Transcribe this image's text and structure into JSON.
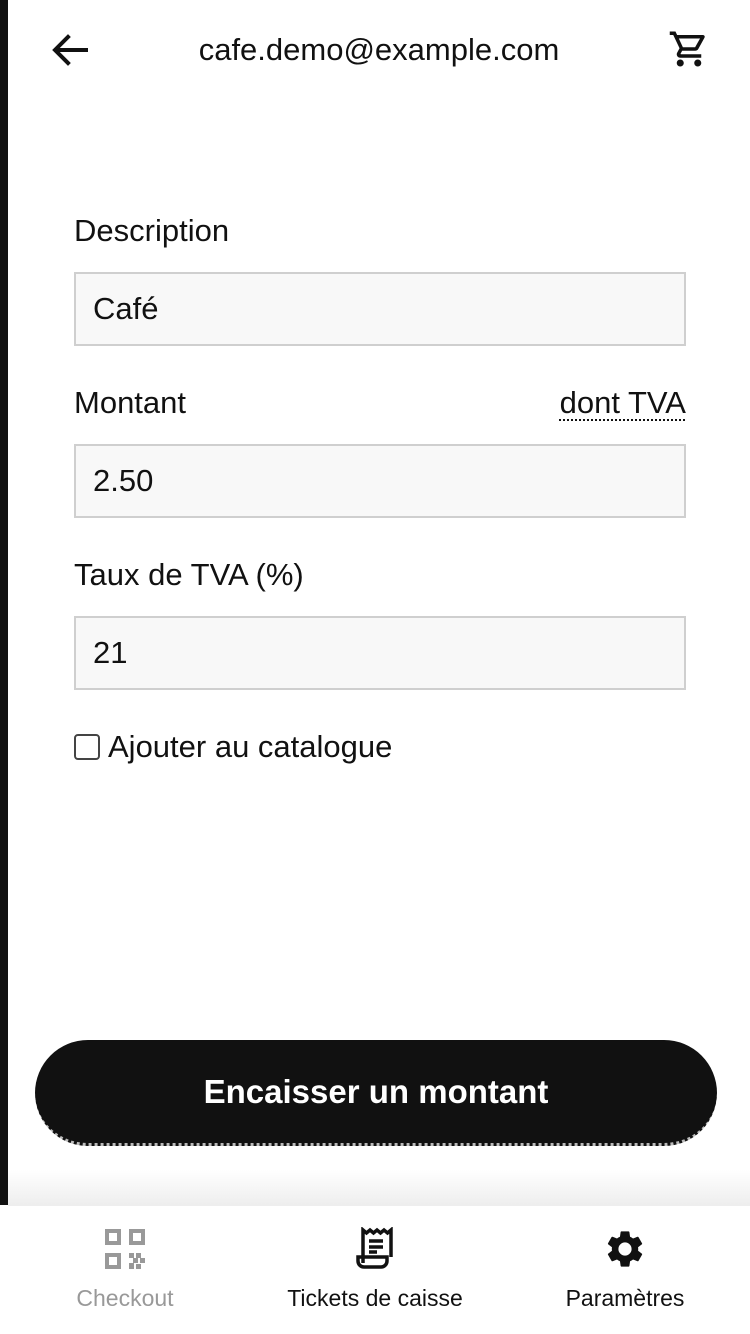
{
  "header": {
    "title": "cafe.demo@example.com",
    "back_icon": "arrow-left-icon",
    "cart_icon": "cart-icon"
  },
  "form": {
    "description_label": "Description",
    "description_value": "Café",
    "amount_label": "Montant",
    "vat_link": "dont TVA",
    "amount_value": "2.50",
    "vat_rate_label": "Taux de TVA (%)",
    "vat_rate_value": "21",
    "catalog_checkbox_label": "Ajouter au catalogue",
    "catalog_checked": false
  },
  "actions": {
    "pay_button": "Encaisser un montant"
  },
  "bottom_nav": {
    "items": [
      {
        "label": "Checkout",
        "icon": "qr-code-icon",
        "active": false
      },
      {
        "label": "Tickets de caisse",
        "icon": "receipt-icon",
        "active": true
      },
      {
        "label": "Paramètres",
        "icon": "gear-icon",
        "active": true
      }
    ]
  },
  "colors": {
    "primary": "#111111",
    "inactive": "#999999",
    "field_bg": "#f8f8f8",
    "field_border": "#cfcfcf"
  }
}
